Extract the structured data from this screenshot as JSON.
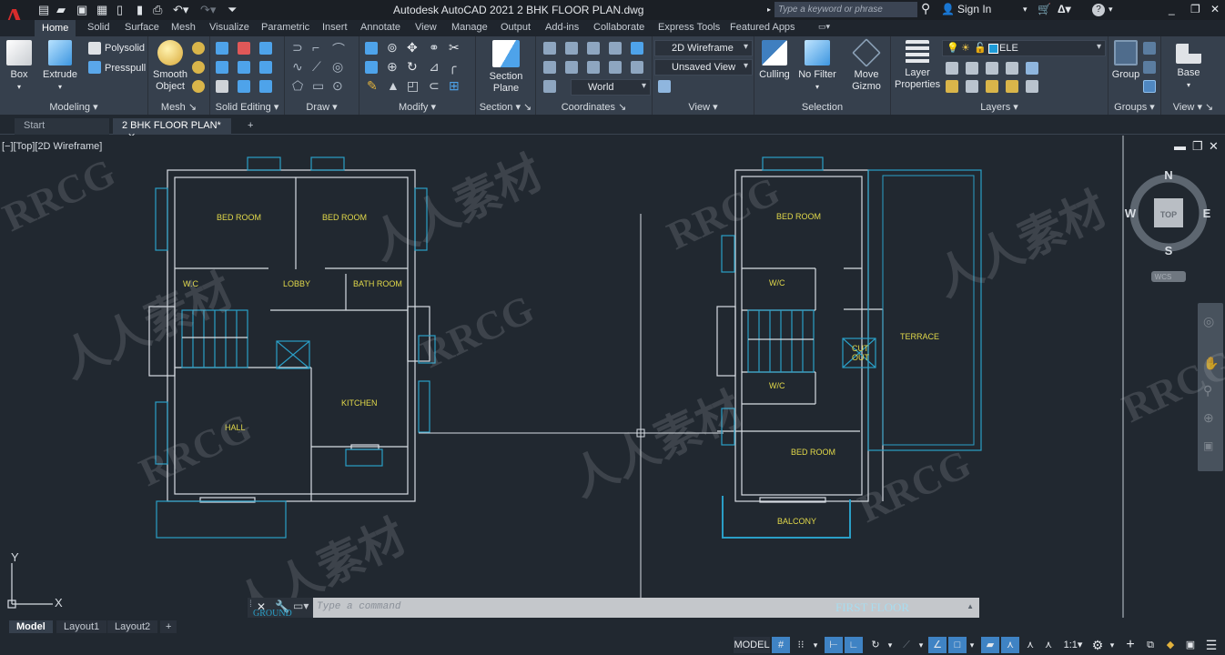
{
  "app": {
    "logo": "A",
    "title": "Autodesk AutoCAD 2021    2 BHK FLOOR PLAN.dwg",
    "search_placeholder": "Type a keyword or phrase",
    "sign_in": "Sign In"
  },
  "quick_access": [
    "new-icon",
    "open-icon",
    "save-icon",
    "save-as-icon",
    "plot-preview-icon",
    "share-icon",
    "print-icon",
    "undo-icon",
    "redo-icon",
    "customize-icon"
  ],
  "ribbon_tabs": [
    "Home",
    "Solid",
    "Surface",
    "Mesh",
    "Visualize",
    "Parametric",
    "Insert",
    "Annotate",
    "View",
    "Manage",
    "Output",
    "Add-ins",
    "Collaborate",
    "Express Tools",
    "Featured Apps"
  ],
  "active_tab": "Home",
  "ribbon": {
    "modeling": {
      "label": "Modeling",
      "box": "Box",
      "extrude": "Extrude",
      "polysolid": "Polysolid",
      "presspull": "Presspull"
    },
    "mesh": {
      "label": "Mesh",
      "smooth_object_1": "Smooth",
      "smooth_object_2": "Object"
    },
    "solid_editing": {
      "label": "Solid Editing"
    },
    "draw": {
      "label": "Draw"
    },
    "modify": {
      "label": "Modify"
    },
    "section": {
      "label": "Section",
      "plane_1": "Section",
      "plane_2": "Plane"
    },
    "coordinates": {
      "label": "Coordinates",
      "ucs": "World"
    },
    "view": {
      "label": "View",
      "visual_style": "2D Wireframe",
      "named_view": "Unsaved View"
    },
    "selection": {
      "label": "Selection",
      "culling": "Culling",
      "no_filter": "No Filter",
      "gizmo_1": "Move",
      "gizmo_2": "Gizmo"
    },
    "layers": {
      "label": "Layers",
      "props_1": "Layer",
      "props_2": "Properties",
      "current_layer": "ELE",
      "layer_color": "#1e9bd7"
    },
    "groups": {
      "label": "Groups",
      "group": "Group"
    },
    "view2": {
      "label": "View",
      "base": "Base"
    }
  },
  "doc_tabs": [
    {
      "label": "Start",
      "active": false
    },
    {
      "label": "2 BHK FLOOR PLAN*",
      "active": true
    }
  ],
  "viewport": {
    "label": "[−][Top][2D Wireframe]",
    "ground_floor_rooms": [
      "BED ROOM",
      "BED ROOM",
      "W.C",
      "LOBBY",
      "BATH ROOM",
      "KITCHEN",
      "HALL"
    ],
    "first_floor_rooms": [
      "BED ROOM",
      "W/C",
      "CUT",
      "OUT",
      "TERRACE",
      "W/C",
      "BED ROOM",
      "BALCONY"
    ],
    "ucs_x": "X",
    "ucs_y": "Y"
  },
  "viewcube": {
    "north": "N",
    "south": "S",
    "east": "E",
    "west": "W",
    "face": "TOP",
    "wcs": "WCS"
  },
  "command_line": {
    "placeholder": "Type a command",
    "ground_floor_label": "GROUND FLOOR",
    "first_floor_label": "FIRST FLOOR"
  },
  "layout_tabs": [
    "Model",
    "Layout1",
    "Layout2"
  ],
  "active_layout": "Model",
  "status_bar": {
    "model": "MODEL",
    "scale": "1:1"
  },
  "watermarks": [
    "RRCG.CN",
    "人人素材",
    "RRCG"
  ]
}
